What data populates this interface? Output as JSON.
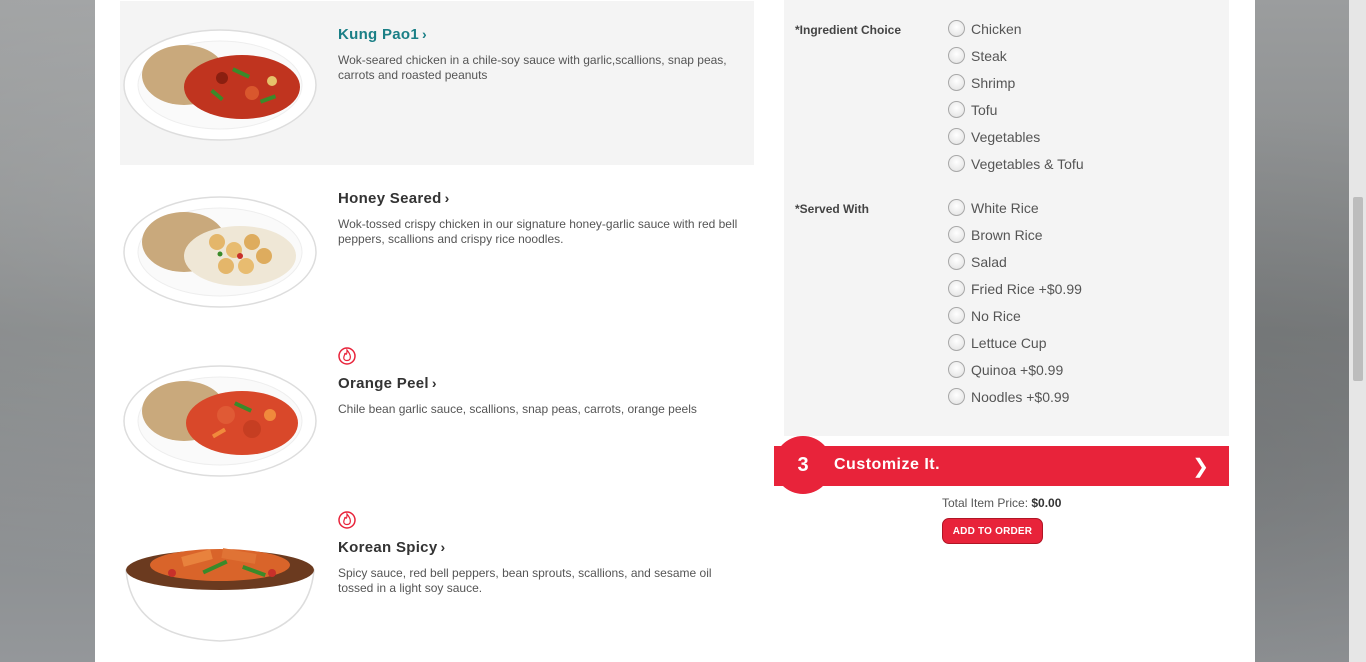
{
  "menu": {
    "items": [
      {
        "name": "Kung Pao1",
        "desc": "Wok-seared chicken in a chile-soy sauce with garlic,scallions, snap peas, carrots and roasted peanuts"
      },
      {
        "name": "Honey Seared",
        "desc": "Wok-tossed crispy chicken in our signature honey-garlic sauce with red bell peppers, scallions and crispy rice noodles."
      },
      {
        "name": "Orange Peel",
        "desc": "Chile bean garlic sauce, scallions, snap peas, carrots, orange peels"
      },
      {
        "name": "Korean Spicy",
        "desc": "Spicy sauce, red bell peppers, bean sprouts, scallions, and sesame oil tossed in a light soy sauce."
      }
    ],
    "chevron": "›"
  },
  "options": {
    "ingredient": {
      "label": "*Ingredient Choice",
      "choices": [
        "Chicken",
        "Steak",
        "Shrimp",
        "Tofu",
        "Vegetables",
        "Vegetables & Tofu"
      ]
    },
    "served": {
      "label": "*Served With",
      "choices": [
        "White Rice",
        "Brown Rice",
        "Salad",
        "Fried Rice +$0.99",
        "No Rice",
        "Lettuce Cup",
        "Quinoa +$0.99",
        "Noodles +$0.99"
      ]
    }
  },
  "customize": {
    "step": "3",
    "label": "Customize It.",
    "chevron": "❯"
  },
  "total": {
    "label": "Total Item Price:",
    "value": "$0.00"
  },
  "add_button": "ADD TO ORDER",
  "colors": {
    "accent_red": "#e8233a",
    "selected_teal": "#1a7f86"
  }
}
